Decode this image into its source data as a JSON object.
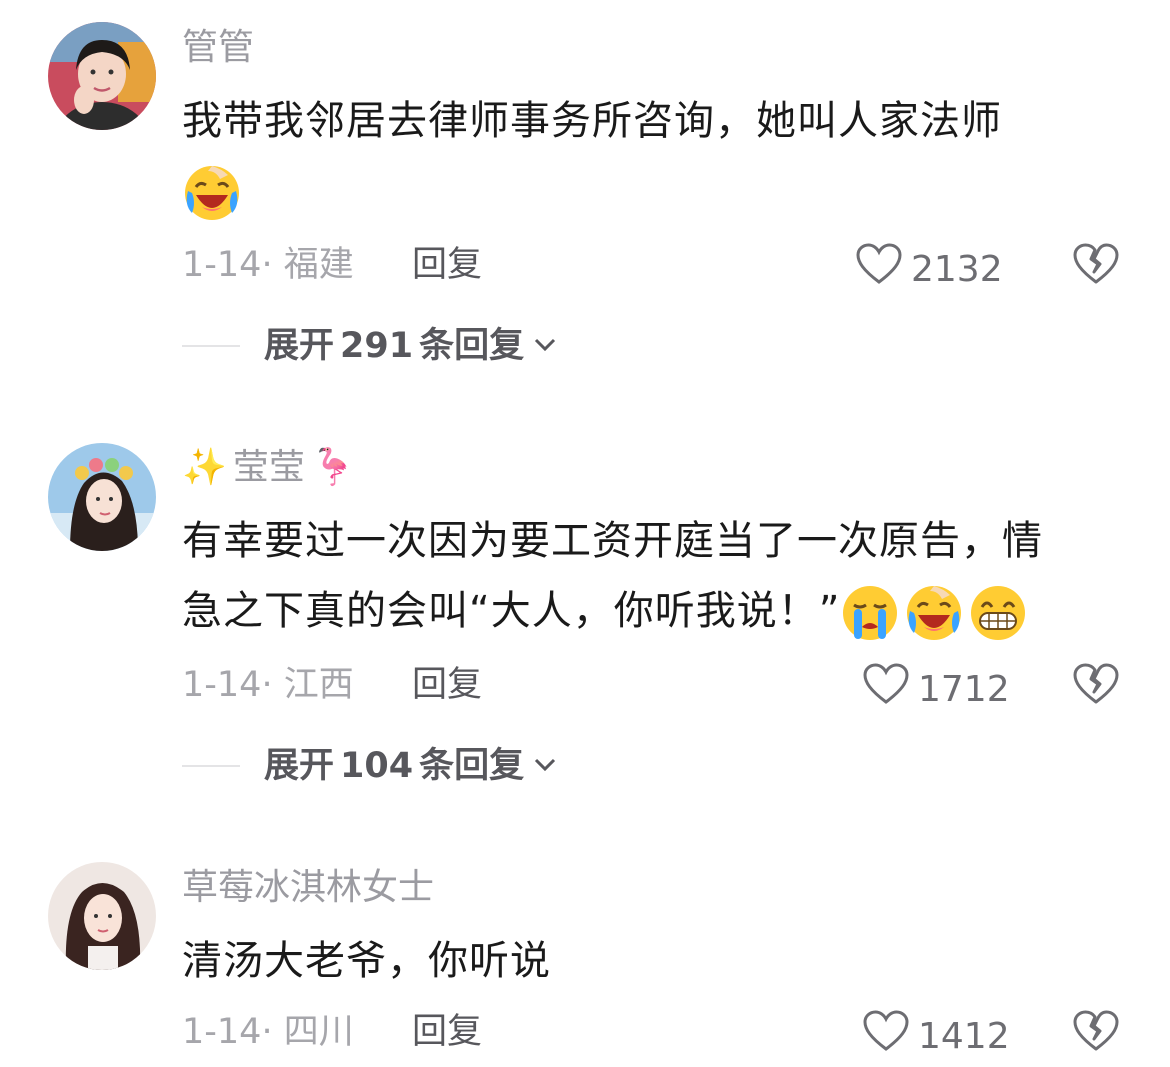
{
  "comments": [
    {
      "username": "管管",
      "text": "我带我邻居去律师事务所咨询，她叫人家法师",
      "emojis": [
        "laugh-cry-emoji"
      ],
      "date": "1-14",
      "location": "福建",
      "reply_label": "回复",
      "likes": "2132",
      "expand_prefix": "展开",
      "expand_count": "291",
      "expand_suffix": "条回复"
    },
    {
      "username_prefix": "✨",
      "username": "莹莹",
      "username_suffix": "🦩",
      "text_line1": "有幸要过一次因为要工资开庭当了一次原告，情",
      "text_line2": "急之下真的会叫“大人，你听我说！”",
      "emojis": [
        "crying-emoji",
        "laugh-cry-emoji",
        "grin-emoji"
      ],
      "date": "1-14",
      "location": "江西",
      "reply_label": "回复",
      "likes": "1712",
      "expand_prefix": "展开",
      "expand_count": "104",
      "expand_suffix": "条回复"
    },
    {
      "username": "草莓冰淇林女士",
      "text": "清汤大老爷，你听说",
      "date": "1-14",
      "location": "四川",
      "reply_label": "回复",
      "likes": "1412"
    }
  ],
  "colors": {
    "username": "#9b9ba1",
    "text": "#1a1a1a",
    "meta": "#a6a6ab",
    "emoji_yellow": "#ffcc33"
  }
}
